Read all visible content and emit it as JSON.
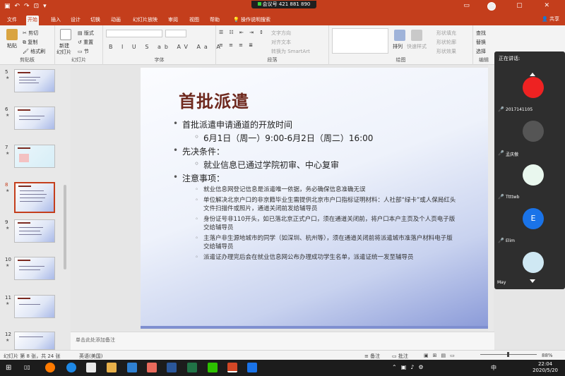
{
  "titlebar": {
    "meeting_id": "会议号 421 881 890"
  },
  "tabs": [
    "文件",
    "开始",
    "插入",
    "设计",
    "切换",
    "动画",
    "幻灯片放映",
    "审阅",
    "视图",
    "帮助",
    "操作说明搜索"
  ],
  "active_tab": "开始",
  "share": "共享",
  "ribbon": {
    "clipboard": {
      "paste": "粘贴",
      "cut": "剪切",
      "copy": "复制",
      "format_painter": "格式刷",
      "label": "剪贴板"
    },
    "slides": {
      "new": "新建",
      "new2": "幻灯片",
      "layout": "版式",
      "reset": "重置",
      "section": "节",
      "label": "幻灯片"
    },
    "font": {
      "label": "字体",
      "format_buttons": "B I U S ab AV Aa A"
    },
    "paragraph": {
      "text_direction": "文字方向",
      "align_text": "对齐文本",
      "smartart": "转换为 SmartArt",
      "label": "段落"
    },
    "drawing": {
      "arrange": "排列",
      "quick_styles": "快速样式",
      "fill": "形状填充",
      "outline": "形状轮廓",
      "effects": "形状效果",
      "label": "绘图"
    },
    "editing": {
      "find": "查找",
      "replace": "替换",
      "select": "选择",
      "label": "编辑"
    }
  },
  "thumbnails": [
    {
      "num": "5",
      "star": "★"
    },
    {
      "num": "6",
      "star": "★"
    },
    {
      "num": "7",
      "star": "★"
    },
    {
      "num": "8",
      "star": "★",
      "selected": true
    },
    {
      "num": "9",
      "star": "★"
    },
    {
      "num": "10",
      "star": "★"
    },
    {
      "num": "11",
      "star": "★"
    },
    {
      "num": "12",
      "star": "★"
    }
  ],
  "slide": {
    "title": "首批派遣",
    "b1": "首批派遣申请通道的开放时间",
    "b1a": "6月1日（周一）9:00-6月2日（周二）16:00",
    "b2": "先决条件：",
    "b2a": "就业信息已通过学院初审、中心复审",
    "b3": "注意事项：",
    "n1": "就业信息网登记信息是派遣唯一依据，务必确保信息准确无误",
    "n2": "单位解决北京户口的非京籍毕业生需提供北京市户口指标证明材料：人社部“绿卡”或人保局红头文件扫描件或照片，通道关闭前发给辅导员",
    "n3": "身份证号非110开头，如已落北京正式户口，须在通道关闭前，将户口本户主页及个人页电子版交给辅导员",
    "n4": "主落户非生源地城市的同学（如深圳、杭州等），须在通道关闭前将派遣城市准落户材料电子版交给辅导员",
    "n5": "派遣证办理完后会在就业信息网公布办理成功学生名单，派遣证统一发至辅导员"
  },
  "notes_placeholder": "单击此处添加备注",
  "participants": {
    "header": "正在讲话:",
    "people": [
      {
        "name": "2017141105"
      },
      {
        "name": "孟庆傲"
      },
      {
        "name": "Ttttwb"
      },
      {
        "name": "Elim",
        "initial": "E"
      },
      {
        "name": "May"
      }
    ]
  },
  "status": {
    "slide_info": "幻灯片 第 8 张，共 24 张",
    "language": "英语(美国)",
    "notes": "备注",
    "comments": "批注",
    "zoom": "88%"
  },
  "taskbar": {
    "time": "22:04",
    "date": "2020/5/20",
    "ime": "中"
  },
  "colors": {
    "accent": "#c43e1c",
    "title": "#6f2a1f"
  }
}
